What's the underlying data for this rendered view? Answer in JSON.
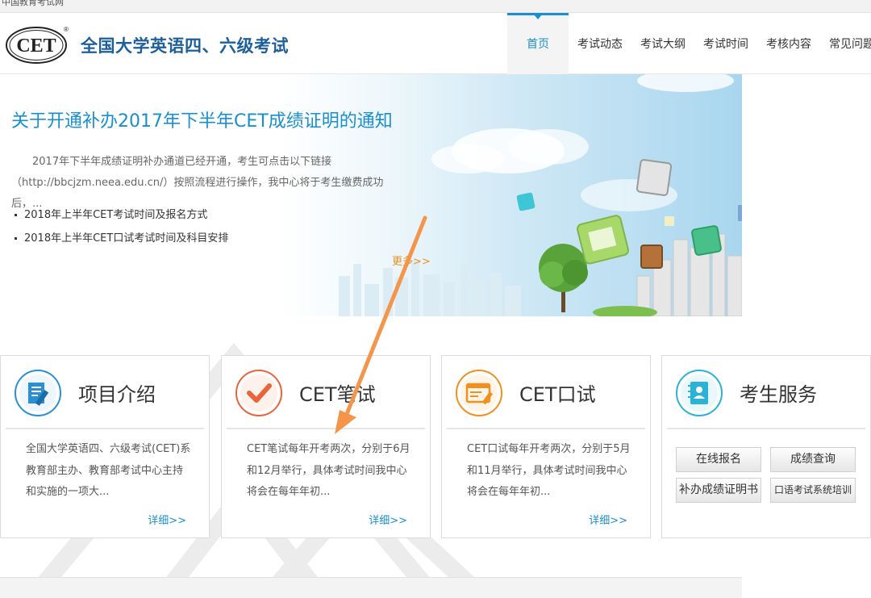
{
  "topbar": {
    "text": "中国教育考试网"
  },
  "header": {
    "logo_text": "CET",
    "logo_mark": "®",
    "site_title": "全国大学英语四、六级考试"
  },
  "nav": [
    {
      "label": "首页",
      "active": true
    },
    {
      "label": "考试动态",
      "active": false
    },
    {
      "label": "考试大纲",
      "active": false
    },
    {
      "label": "考试时间",
      "active": false
    },
    {
      "label": "考核内容",
      "active": false
    },
    {
      "label": "常见问题",
      "active": false
    }
  ],
  "banner": {
    "title": "关于开通补办2017年下半年CET成绩证明的通知",
    "text": "2017年下半年成绩证明补办通道已经开通，考生可点击以下链接（http://bbcjzm.neea.edu.cn/）按照流程进行操作，我中心将于考生缴费成功后，...",
    "links": [
      "2018年上半年CET考试时间及报名方式",
      "2018年上半年CET口试考试时间及科目安排"
    ],
    "more": "更多>>"
  },
  "cards": [
    {
      "icon": "document-edit-icon",
      "title": "项目介绍",
      "text": "全国大学英语四、六级考试(CET)系教育部主办、教育部考试中心主持和实施的一项大...",
      "more": "详细>>"
    },
    {
      "icon": "checkmark-icon",
      "title": "CET笔试",
      "text": "CET笔试每年开考两次，分别于6月和12月举行，具体考试时间我中心将会在每年年初...",
      "more": "详细>>"
    },
    {
      "icon": "screen-pen-icon",
      "title": "CET口试",
      "text": "CET口试每年开考两次，分别于5月和11月举行，具体考试时间我中心将会在每年年初...",
      "more": "详细>>"
    },
    {
      "icon": "contact-book-icon",
      "title": "考生服务",
      "buttons": [
        "在线报名",
        "成绩查询",
        "补办成绩证明书",
        "口语考试系统培训"
      ]
    }
  ],
  "colors": {
    "accent": "#1a8fd0",
    "orange": "#f0901e",
    "title_blue": "#1d5f9a"
  }
}
